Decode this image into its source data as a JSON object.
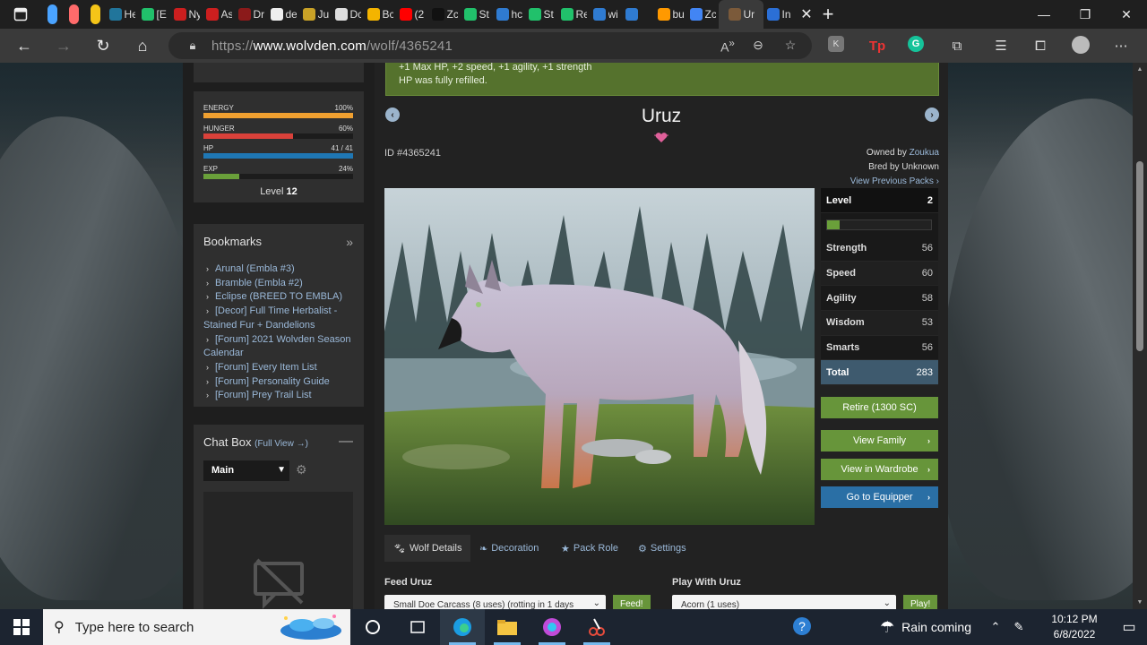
{
  "browser": {
    "tabs": [
      {
        "title": "",
        "color": "#4aa3ff"
      },
      {
        "title": "",
        "color": "#ff6b6b"
      },
      {
        "title": "",
        "color": "#f5c518"
      },
      {
        "title": "He",
        "color": "#21759b"
      },
      {
        "title": "[E",
        "color": "#21c16b"
      },
      {
        "title": "Ny",
        "color": "#cc1f1f"
      },
      {
        "title": "As",
        "color": "#cc1f1f"
      },
      {
        "title": "Dr",
        "color": "#8b1a1a"
      },
      {
        "title": "de",
        "color": "#eeeeee"
      },
      {
        "title": "Ju",
        "color": "#c9a227"
      },
      {
        "title": "Dc",
        "color": "#dddddd"
      },
      {
        "title": "Bc",
        "color": "#f4b400"
      },
      {
        "title": "(2",
        "color": "#ff0000"
      },
      {
        "title": "Zc",
        "color": "#111111"
      },
      {
        "title": "St",
        "color": "#21c16b"
      },
      {
        "title": "hc",
        "color": "#2f7bd1"
      },
      {
        "title": "St",
        "color": "#21c16b"
      },
      {
        "title": "Re",
        "color": "#21c16b"
      },
      {
        "title": "wi",
        "color": "#2f7bd1"
      },
      {
        "title": "",
        "color": "#2f7bd1"
      },
      {
        "title": "bu",
        "color": "#ff9900"
      },
      {
        "title": "Zc",
        "color": "#4285f4"
      },
      {
        "title": "Ur",
        "color": "#7b5a3a"
      },
      {
        "title": "In",
        "color": "#2b6fd6"
      }
    ],
    "active_tab_title": "Ur",
    "url_prefix": "https://",
    "url_host": "www.wolvden.com",
    "url_path": "/wolf/4365241"
  },
  "sidebar": {
    "stats": [
      {
        "label": "ENERGY",
        "value": "100%",
        "fill": 1.0,
        "color": "#f0a030"
      },
      {
        "label": "HUNGER",
        "value": "60%",
        "fill": 0.6,
        "color": "#d9413a"
      },
      {
        "label": "HP",
        "value": "41 / 41",
        "fill": 1.0,
        "color": "#1f77b4"
      },
      {
        "label": "EXP",
        "value": "24%",
        "fill": 0.24,
        "color": "#6aa03a"
      }
    ],
    "level_prefix": "Level",
    "level_value": "12",
    "bookmarks_title": "Bookmarks",
    "bookmarks": [
      "Arunal (Embla #3)",
      "Bramble (Embla #2)",
      "Eclipse (BREED TO EMBLA)",
      "[Decor] Full Time Herbalist - Stained Fur + Dandelions",
      "[Forum] 2021 Wolvden Season Calendar",
      "[Forum] Every Item List",
      "[Forum] Personality Guide",
      "[Forum] Prey Trail List"
    ],
    "chat_title": "Chat Box",
    "chat_full_view": "(Full View →)",
    "chat_channel": "Main"
  },
  "main": {
    "banner_line1": "+1 Max HP, +2 speed, +1 agility, +1 strength",
    "banner_line2": "HP was fully refilled.",
    "wolf_name": "Uruz",
    "wolf_id": "ID #4365241",
    "owned_by_prefix": "Owned by",
    "owner": "Zoukua",
    "bred_by": "Bred by Unknown",
    "previous_packs": "View Previous Packs ›",
    "stats": {
      "level_label": "Level",
      "level_value": "2",
      "xp_fill": 0.12,
      "rows": [
        {
          "label": "Strength",
          "value": "56"
        },
        {
          "label": "Speed",
          "value": "60"
        },
        {
          "label": "Agility",
          "value": "58"
        },
        {
          "label": "Wisdom",
          "value": "53"
        },
        {
          "label": "Smarts",
          "value": "56"
        }
      ],
      "total_label": "Total",
      "total_value": "283"
    },
    "retire_button": "Retire (1300 SC)",
    "family_button": "View Family",
    "wardrobe_button": "View in Wardrobe",
    "equipper_button": "Go to Equipper",
    "tabs": [
      {
        "label": "Wolf Details",
        "icon": "paw-icon"
      },
      {
        "label": "Decoration",
        "icon": "leaf-icon"
      },
      {
        "label": "Pack Role",
        "icon": "star-icon"
      },
      {
        "label": "Settings",
        "icon": "gear-icon"
      }
    ],
    "feed_title": "Feed Uruz",
    "feed_select": "Small Doe Carcass (8 uses) (rotting in 1 days",
    "feed_button": "Feed!",
    "play_title": "Play With Uruz",
    "play_select": "Acorn (1 uses)",
    "play_button": "Play!"
  },
  "taskbar": {
    "search_placeholder": "Type here to search",
    "weather": "Rain coming",
    "time": "10:12 PM",
    "date": "6/8/2022"
  }
}
